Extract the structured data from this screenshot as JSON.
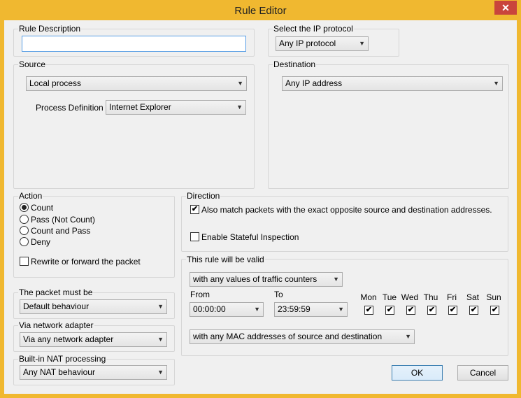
{
  "window": {
    "title": "Rule Editor",
    "close_glyph": "✕"
  },
  "rule_description": {
    "label": "Rule Description",
    "value": ""
  },
  "ip_protocol": {
    "label": "Select the IP protocol",
    "value": "Any IP protocol"
  },
  "source": {
    "label": "Source",
    "value": "Local process",
    "process_definition_label": "Process Definition :",
    "process_definition_value": "Internet Explorer"
  },
  "destination": {
    "label": "Destination",
    "value": "Any IP address"
  },
  "action": {
    "label": "Action",
    "options": [
      "Count",
      "Pass (Not Count)",
      "Count and Pass",
      "Deny"
    ],
    "selected": "Count",
    "rewrite_label": "Rewrite or forward the packet",
    "rewrite_checked": false
  },
  "direction": {
    "label": "Direction",
    "match_opposite_label": "Also match packets with the exact opposite source and destination addresses.",
    "match_opposite_checked": true,
    "stateful_label": "Enable Stateful Inspection",
    "stateful_checked": false
  },
  "packet_must_be": {
    "label": "The packet must be",
    "value": "Default behaviour"
  },
  "network_adapter": {
    "label": "Via network adapter",
    "value": "Via any network adapter"
  },
  "nat": {
    "label": "Built-in NAT processing",
    "value": "Any NAT behaviour"
  },
  "validity": {
    "label": "This rule will be valid",
    "counters_value": "with any values of traffic counters",
    "from_label": "From",
    "from_value": "00:00:00",
    "to_label": "To",
    "to_value": "23:59:59",
    "days": [
      {
        "label": "Mon",
        "checked": true
      },
      {
        "label": "Tue",
        "checked": true
      },
      {
        "label": "Wed",
        "checked": true
      },
      {
        "label": "Thu",
        "checked": true
      },
      {
        "label": "Fri",
        "checked": true
      },
      {
        "label": "Sat",
        "checked": true
      },
      {
        "label": "Sun",
        "checked": true
      }
    ],
    "mac_value": "with any MAC addresses of source and destination"
  },
  "buttons": {
    "ok": "OK",
    "cancel": "Cancel"
  },
  "icons": {
    "dropdown_arrow": "▼",
    "check": "✔"
  },
  "colors": {
    "title_bar": "#f0b830",
    "close_button": "#c9443c",
    "dialog_bg": "#f0f0f0",
    "focus_border": "#569de5"
  }
}
